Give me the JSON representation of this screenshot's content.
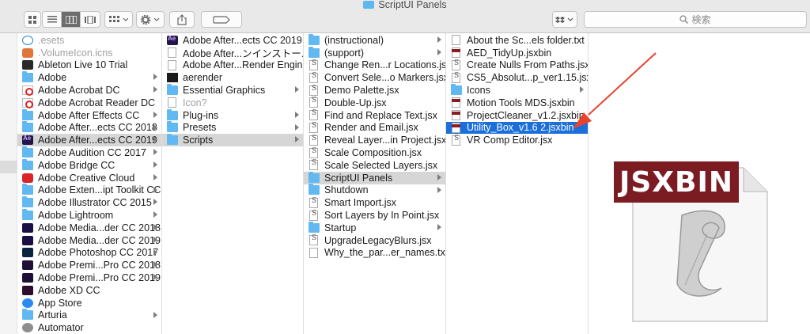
{
  "window": {
    "title": "ScriptUI Panels"
  },
  "toolbar": {
    "search_placeholder": "検索",
    "view_modes": [
      "icon-view",
      "list-view",
      "column-view",
      "gallery-view"
    ],
    "active_view": "column-view"
  },
  "columns": [
    {
      "items": [
        {
          "label": ".esets",
          "icon": "esets-icon",
          "dim": true
        },
        {
          "label": ".VolumeIcon.icns",
          "icon": "icns-icon",
          "dim": true
        },
        {
          "label": "Ableton Live 10 Trial",
          "icon": "ableton-icon"
        },
        {
          "label": "Adobe",
          "icon": "folder-icon",
          "chev": true
        },
        {
          "label": "Adobe Acrobat DC",
          "icon": "pdf-icon",
          "chev": true
        },
        {
          "label": "Adobe Acrobat Reader DC",
          "icon": "pdf-icon"
        },
        {
          "label": "Adobe After Effects CC",
          "icon": "folder-icon",
          "chev": true
        },
        {
          "label": "Adobe After...ects CC 2018",
          "icon": "folder-icon",
          "chev": true
        },
        {
          "label": "Adobe After...ects CC 2019",
          "icon": "after-effects-icon",
          "chev": true,
          "selected": true
        },
        {
          "label": "Adobe Audition CC 2017",
          "icon": "folder-icon",
          "chev": true
        },
        {
          "label": "Adobe Bridge CC",
          "icon": "folder-icon",
          "chev": true
        },
        {
          "label": "Adobe Creative Cloud",
          "icon": "creative-cloud-icon",
          "chev": true
        },
        {
          "label": "Adobe Exten...ipt Toolkit CC",
          "icon": "folder-icon",
          "chev": true
        },
        {
          "label": "Adobe Illustrator CC 2015",
          "icon": "folder-icon",
          "chev": true
        },
        {
          "label": "Adobe Lightroom",
          "icon": "folder-icon",
          "chev": true
        },
        {
          "label": "Adobe Media...der CC 2018",
          "icon": "media-encoder-icon",
          "chev": true
        },
        {
          "label": "Adobe Media...der CC 2019",
          "icon": "media-encoder-icon",
          "chev": true
        },
        {
          "label": "Adobe Photoshop CC 2017",
          "icon": "photoshop-icon",
          "chev": true
        },
        {
          "label": "Adobe Premi...Pro CC 2018",
          "icon": "premiere-icon",
          "chev": true
        },
        {
          "label": "Adobe Premi...Pro CC 2019",
          "icon": "premiere-icon",
          "chev": true
        },
        {
          "label": "Adobe XD CC",
          "icon": "xd-icon"
        },
        {
          "label": "App Store",
          "icon": "app-store-icon"
        },
        {
          "label": "Arturia",
          "icon": "folder-icon",
          "chev": true
        },
        {
          "label": "Automator",
          "icon": "automator-icon"
        }
      ]
    },
    {
      "items": [
        {
          "label": "Adobe After...ects CC 2019",
          "icon": "after-effects-icon"
        },
        {
          "label": "Adobe After...ンインストール",
          "icon": "uninstaller-icon"
        },
        {
          "label": "Adobe After...Render Engine",
          "icon": "uninstaller-icon"
        },
        {
          "label": "aerender",
          "icon": "terminal-icon"
        },
        {
          "label": "Essential Graphics",
          "icon": "folder-icon",
          "chev": true
        },
        {
          "label": "Icon?",
          "icon": "document-icon",
          "dim": true
        },
        {
          "label": "Plug-ins",
          "icon": "folder-icon",
          "chev": true
        },
        {
          "label": "Presets",
          "icon": "folder-icon",
          "chev": true
        },
        {
          "label": "Scripts",
          "icon": "folder-icon",
          "chev": true,
          "selected": true
        }
      ]
    },
    {
      "items": [
        {
          "label": "(instructional)",
          "icon": "folder-icon",
          "chev": true
        },
        {
          "label": "(support)",
          "icon": "folder-icon",
          "chev": true
        },
        {
          "label": "Change Ren...r Locations.jsx",
          "icon": "jsx-icon"
        },
        {
          "label": "Convert Sele...o Markers.jsx",
          "icon": "jsx-icon"
        },
        {
          "label": "Demo Palette.jsx",
          "icon": "jsx-icon"
        },
        {
          "label": "Double-Up.jsx",
          "icon": "jsx-icon"
        },
        {
          "label": "Find and Replace Text.jsx",
          "icon": "jsx-icon"
        },
        {
          "label": "Render and Email.jsx",
          "icon": "jsx-icon"
        },
        {
          "label": "Reveal Layer...in Project.jsx",
          "icon": "jsx-icon"
        },
        {
          "label": "Scale Composition.jsx",
          "icon": "jsx-icon"
        },
        {
          "label": "Scale Selected Layers.jsx",
          "icon": "jsx-icon"
        },
        {
          "label": "ScriptUI Panels",
          "icon": "folder-icon",
          "chev": true,
          "selected": true
        },
        {
          "label": "Shutdown",
          "icon": "folder-icon",
          "chev": true
        },
        {
          "label": "Smart Import.jsx",
          "icon": "jsx-icon"
        },
        {
          "label": "Sort Layers by In Point.jsx",
          "icon": "jsx-icon"
        },
        {
          "label": "Startup",
          "icon": "folder-icon",
          "chev": true
        },
        {
          "label": "UpgradeLegacyBlurs.jsx",
          "icon": "jsx-icon"
        },
        {
          "label": "Why_the_par...er_names.txt",
          "icon": "document-icon"
        }
      ]
    },
    {
      "items": [
        {
          "label": "About the Sc...els folder.txt",
          "icon": "document-icon"
        },
        {
          "label": "AED_TidyUp.jsxbin",
          "icon": "jsxbin-icon"
        },
        {
          "label": "Create Nulls From Paths.jsx",
          "icon": "jsx-icon"
        },
        {
          "label": "CS5_Absolut...p_ver1.15.jsx",
          "icon": "jsx-icon"
        },
        {
          "label": "Icons",
          "icon": "folder-icon",
          "chev": true
        },
        {
          "label": "Motion Tools MDS.jsxbin",
          "icon": "jsxbin-icon"
        },
        {
          "label": "ProjectCleaner_v1.2.jsxbin",
          "icon": "jsxbin-icon"
        },
        {
          "label": "Utility_Box_v1.6 2.jsxbin",
          "icon": "jsxbin-icon",
          "active": true
        },
        {
          "label": "VR Comp Editor.jsx",
          "icon": "jsx-icon"
        }
      ]
    }
  ],
  "preview": {
    "badge_text": "JSXBIN",
    "badge_color": "#7a1c22"
  },
  "annotation": {
    "arrow_color": "#e8432e"
  }
}
